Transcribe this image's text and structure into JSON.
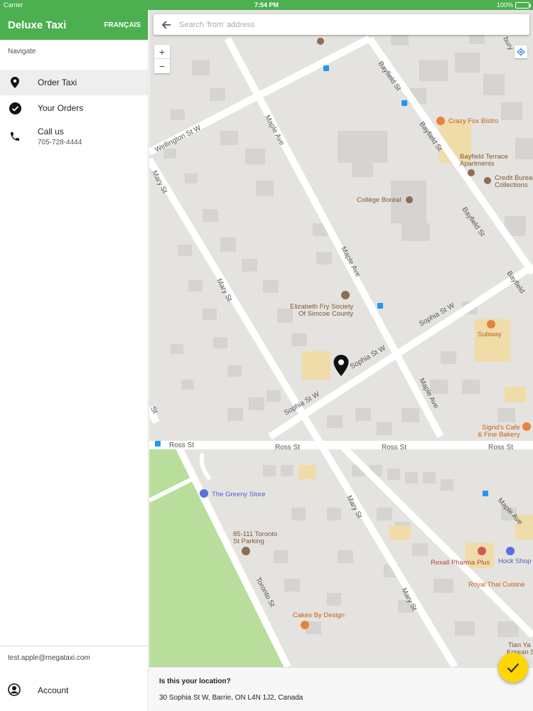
{
  "status_bar": {
    "carrier": "Carrier",
    "time": "7:54 PM",
    "battery": "100%"
  },
  "sidebar": {
    "app_title": "Deluxe Taxi",
    "language_button": "FRANÇAIS",
    "nav_heading": "Navigate",
    "items": [
      {
        "label": "Order Taxi",
        "icon": "location-pin-icon",
        "selected": true
      },
      {
        "label": "Your Orders",
        "icon": "check-circle-icon"
      },
      {
        "label": "Call us",
        "sublabel": "705-728-4444",
        "icon": "phone-icon"
      }
    ],
    "user_email": "test.apple@megataxi.com",
    "account_label": "Account"
  },
  "search": {
    "placeholder": "Search 'from' address",
    "value": ""
  },
  "map": {
    "zoom_in": "+",
    "zoom_out": "−",
    "streets": {
      "wellington": "Wellington St W",
      "maple1": "Maple Ave",
      "maple2": "Maple Ave",
      "maple3": "Maple Ave",
      "maple4": "Maple Ave",
      "mary1": "Mary St",
      "mary2": "Mary St",
      "mary3": "Mary St",
      "mary4": "Mary St",
      "mary5": "St",
      "bayfield1": "Bayfield St",
      "bayfield2": "Bayfield St",
      "bayfield3": "Bayfield St",
      "bayfield4": "Bayfield",
      "sophia1": "Sophia St W",
      "sophia2": "Sophia St W",
      "sophia3": "Sophia St W",
      "ross1": "Ross St",
      "ross2": "Ross St",
      "ross3": "Ross St",
      "ross4": "Ross St",
      "toronto": "Toronto St",
      "top_right": "bury"
    },
    "places": {
      "crazy_fox": "Crazy Fox Bistro",
      "bayfield_terrace_1": "Bayfield Terrace",
      "bayfield_terrace_2": "Apartments",
      "credit_1": "Credit Burea",
      "credit_2": "Collections",
      "college": "Collège Boréal",
      "efry_1": "Elizabeth Fry Society",
      "efry_2": "Of Simcoe County",
      "subway": "Subway",
      "sigrid_1": "Sigrid's Cafe",
      "sigrid_2": "& Fine Bakery",
      "greeny": "The Greeny Store",
      "parking_1": "85-111 Toronto",
      "parking_2": "St Parking",
      "rexall": "Rexall Pharma Plus",
      "hock": "Hock Shop",
      "royal_thai": "Royal Thai Cuisine",
      "cakes": "Cakes By Design",
      "tian_1": "Tian Ya",
      "tian_2": "Korean S"
    }
  },
  "confirm": {
    "question": "Is this your location?",
    "address": "30 Sophia St W, Barrie, ON L4N 1J2, Canada"
  },
  "colors": {
    "primary": "#4CAF50",
    "fab": "#FFD600",
    "park": "#B9DE9C"
  }
}
